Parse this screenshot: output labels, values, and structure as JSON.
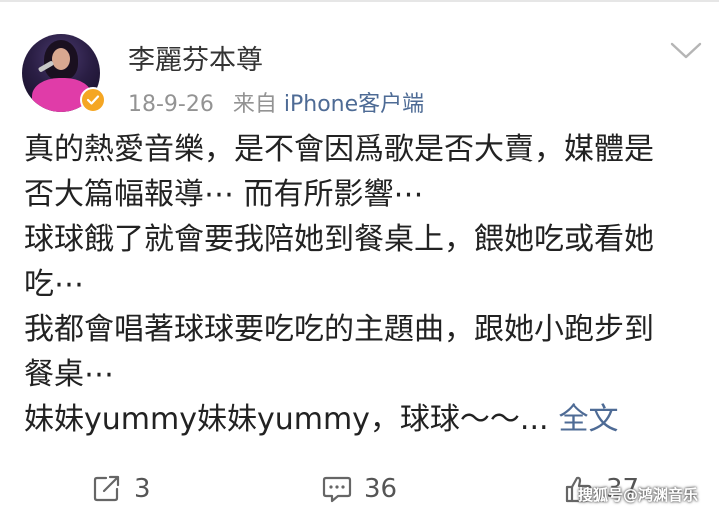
{
  "post": {
    "username": "李麗芬本尊",
    "date": "18-9-26",
    "source_prefix": "来自",
    "source_client": "iPhone客户端",
    "content_lines": [
      "真的熱愛音樂，是不會因爲歌是否大賣，媒體是",
      "否大篇幅報導⋯ 而有所影響⋯",
      "球球餓了就會要我陪她到餐桌上，餵她吃或看她",
      "吃⋯",
      "我都會唱著球球要吃吃的主題曲，跟她小跑步到",
      "餐桌⋯",
      "妹妹yummy妹妹yummy，球球～～..."
    ],
    "more_link": "全文"
  },
  "actions": {
    "repost_count": "3",
    "comment_count": "36",
    "like_count": "37"
  },
  "watermark": "搜狐号@鸿渊音乐",
  "icons": {
    "avatar": "avatar",
    "verified": "verified-badge-icon",
    "menu": "chevron-down-icon",
    "repost": "repost-icon",
    "comment": "comment-icon",
    "like": "like-icon"
  },
  "colors": {
    "link": "#4e6b95",
    "verified": "#f5a623",
    "text": "#222222",
    "meta": "#939393"
  }
}
